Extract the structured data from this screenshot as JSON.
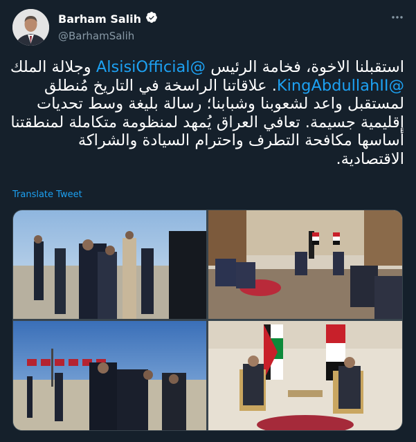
{
  "author": {
    "display_name": "Barham Salih",
    "handle": "@BarhamSalih",
    "verified_icon": "verified-badge-icon",
    "more_icon": "more-options-icon"
  },
  "tweet": {
    "seg1": "استقبلنا الاخوة، فخامة الرئيس ",
    "mention1": "@AlsisiOfficial",
    "seg2": " وجلالة الملك ",
    "mention2": "@KingAbdullahII",
    "seg3": ". علاقاتنا الراسخة في التاريخ مُنطلق لمستقبل واعد لشعوبنا وشبابنا؛ رسالة بليغة وسط تحديات إقليمية جسيمة. تعافي العراق يُمهد لمنظومة متكاملة لمنطقتنا أساسها مكافحة التطرف واحترام السيادة والشراكة الاقتصادية."
  },
  "translate_label": "Translate Tweet",
  "colors": {
    "background": "#15202b",
    "link": "#1da1f2",
    "secondary_text": "#8899a6",
    "border": "#38444d"
  }
}
